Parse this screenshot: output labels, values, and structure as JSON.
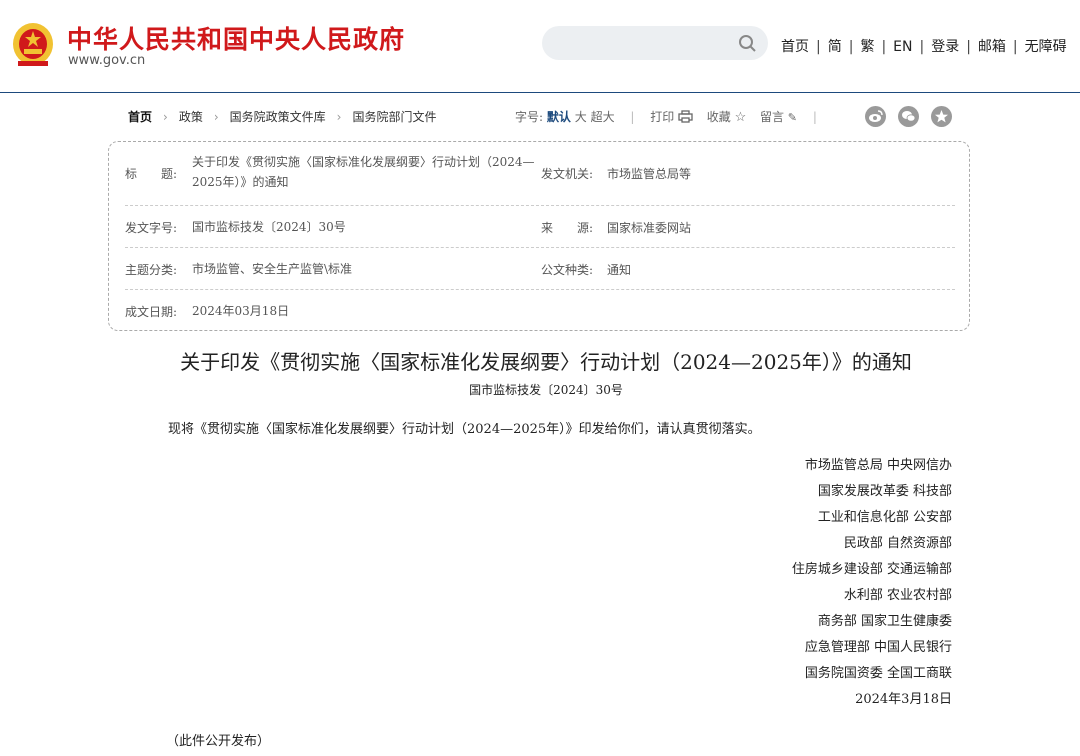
{
  "header": {
    "site_title": "中华人民共和国中央人民政府",
    "site_url": "www.gov.cn",
    "search_placeholder": "",
    "nav": [
      "首页",
      "简",
      "繁",
      "EN",
      "登录",
      "邮箱",
      "无障碍"
    ]
  },
  "breadcrumb": [
    "首页",
    "政策",
    "国务院政策文件库",
    "国务院部门文件"
  ],
  "tools": {
    "font_label": "字号:",
    "font_sizes": [
      "默认",
      "大",
      "超大"
    ],
    "print": "打印",
    "favorite": "收藏",
    "comment": "留言"
  },
  "share_icons": [
    "weibo-icon",
    "wechat-icon",
    "star-icon"
  ],
  "info": {
    "title_label": "标　　题:",
    "title_line1": "关于印发《贯彻实施〈国家标准化发展纲要〉行动计划（2024—",
    "title_line2": "2025年）》的通知",
    "issuer_label": "发文机关:",
    "issuer": "市场监管总局等",
    "doc_no_label": "发文字号:",
    "doc_no": "国市监标技发〔2024〕30号",
    "source_label": "来　　源:",
    "source": "国家标准委网站",
    "topic_label": "主题分类:",
    "topic": "市场监管、安全生产监管\\标准",
    "type_label": "公文种类:",
    "type": "通知",
    "date_label": "成文日期:",
    "date": "2024年03月18日"
  },
  "document": {
    "title": "关于印发《贯彻实施〈国家标准化发展纲要〉行动计划（2024—2025年）》的通知",
    "doc_no": "国市监标技发〔2024〕30号",
    "body": "现将《贯彻实施〈国家标准化发展纲要〉行动计划（2024—2025年）》印发给你们，请认真贯彻落实。",
    "signers": [
      "市场监管总局 中央网信办",
      "国家发展改革委 科技部",
      "工业和信息化部 公安部",
      "民政部 自然资源部",
      "住房城乡建设部 交通运输部",
      "水利部 农业农村部",
      "商务部 国家卫生健康委",
      "应急管理部 中国人民银行",
      "国务院国资委 全国工商联",
      "2024年3月18日"
    ],
    "public_note": "（此件公开发布）"
  },
  "colors": {
    "brand_red": "#d0191b",
    "accent_blue": "#1d4a7d"
  }
}
